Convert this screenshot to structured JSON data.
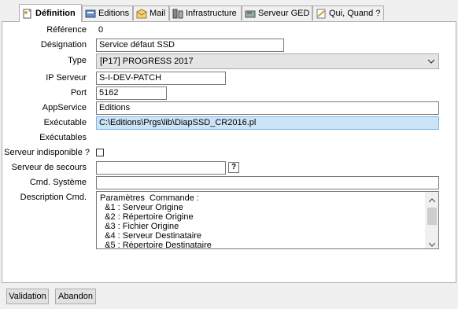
{
  "tabs": [
    {
      "label": "Définition",
      "icon": "definition-icon"
    },
    {
      "label": "Editions",
      "icon": "editions-icon"
    },
    {
      "label": "Mail",
      "icon": "mail-icon"
    },
    {
      "label": "Infrastructure",
      "icon": "infrastructure-icon"
    },
    {
      "label": "Serveur GED",
      "icon": "server-icon"
    },
    {
      "label": "Qui, Quand ?",
      "icon": "who-when-icon"
    }
  ],
  "form": {
    "reference_label": "Référence",
    "reference_value": "0",
    "designation_label": "Désignation",
    "designation_value": "Service  défaut SSD",
    "type_label": "Type",
    "type_value": "[P17] PROGRESS 2017",
    "ip_label": "IP Serveur",
    "ip_value": "S-I-DEV-PATCH",
    "port_label": "Port",
    "port_value": "5162",
    "appservice_label": "AppService",
    "appservice_value": "Editions",
    "executable_label": "Exécutable",
    "executable_value": "C:\\Editions\\Prgs\\lib\\DiapSSD_CR2016.pl",
    "executables_label": "Exécutables",
    "unavailable_label": "Serveur indisponible ?",
    "backup_label": "Serveur de secours",
    "backup_value": "",
    "backup_help": "?",
    "cmd_label": "Cmd. Système",
    "cmd_value": "",
    "desc_label": "Description Cmd.",
    "desc_lines": [
      "Paramètres  Commande :",
      "  &1 : Serveur Origine",
      "  &2 : Répertoire Origine",
      "  &3 : Fichier Origine",
      "  &4 : Serveur Destinataire",
      "  &5 : Répertoire Destinataire"
    ]
  },
  "buttons": {
    "validate": "Validation",
    "cancel": "Abandon"
  }
}
